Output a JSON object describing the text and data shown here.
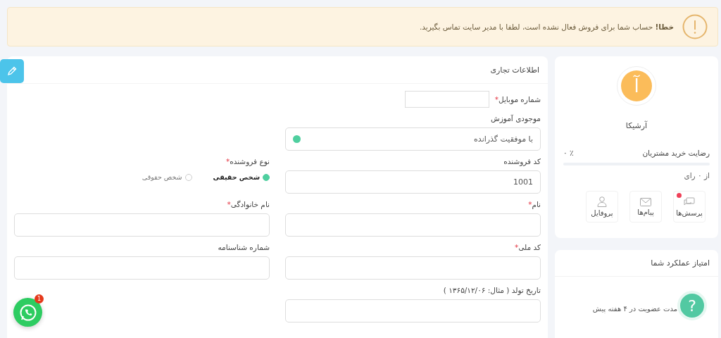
{
  "alert": {
    "text": "**خطا!** حساب شما برای فروش فعال نشده است، لطفا با مدیر سایت تماس بگیرید."
  },
  "profile": {
    "avatar_letter": "آ",
    "name": "آرشیکا",
    "satisfaction": {
      "label": "رضایت خرید مشتریان",
      "value": "٪ ۰",
      "level": 0,
      "votes": "از ۰ رای"
    },
    "tiles": [
      {
        "label": "پرسش‌ها",
        "notify": true
      },
      {
        "label": "پیام‌ها",
        "notify": false
      },
      {
        "label": "پروفایل",
        "notify": false
      }
    ]
  },
  "performance": {
    "title": "امتیاز عملکرد شما",
    "membership": "مدت عضویت در ۴ هفته پیش"
  },
  "form": {
    "title": "اطلاعات تجاری",
    "required_mark": "*",
    "rows": [
      [
        {
          "kind": "inline",
          "label": "شماره موبایل",
          "required": true
        }
      ],
      [
        {
          "kind": "status",
          "label": "موجودی آموزش",
          "required": false,
          "value": "با موفقیت گذرانده"
        }
      ],
      [
        {
          "kind": "text",
          "label": "کد فروشنده",
          "required": false,
          "value": "1001"
        },
        {
          "kind": "radio",
          "label": "نوع فروشنده",
          "required": true,
          "options": [
            {
              "label": "شخص حقیقی",
              "selected": true
            },
            {
              "label": "شخص حقوقی",
              "selected": false
            }
          ]
        }
      ],
      [
        {
          "kind": "text",
          "label": "نام",
          "required": true
        },
        {
          "kind": "text",
          "label": "نام خانوادگی",
          "required": true
        }
      ],
      [
        {
          "kind": "text",
          "label": "کد ملی",
          "required": true
        },
        {
          "kind": "text",
          "label": "شماره شناسنامه",
          "required": false
        }
      ],
      [
        {
          "kind": "text",
          "label": "تاریخ تولد ( مثال: ۱۳۶۵/۱۲/۰۶ )",
          "required": false
        }
      ]
    ]
  },
  "help_button": {
    "label": "?"
  },
  "whatsapp": {
    "badge": "1"
  }
}
